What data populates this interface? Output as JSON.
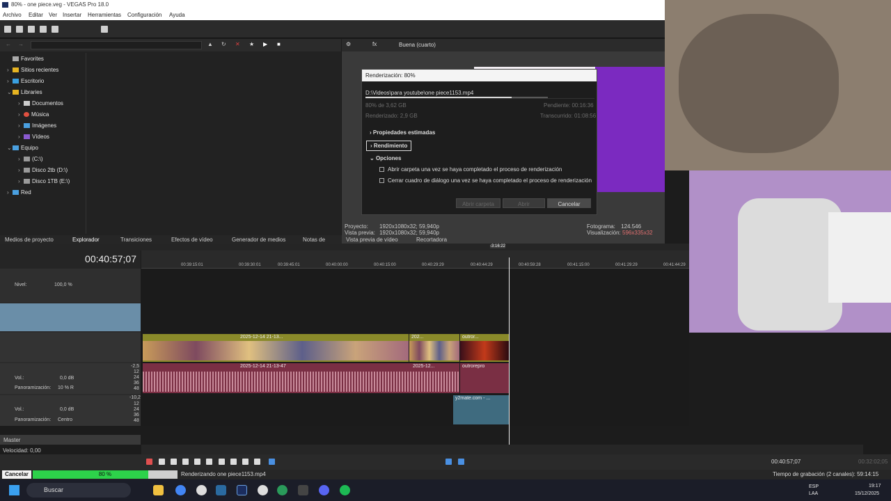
{
  "window": {
    "title": "80% - one piece.veg - VEGAS Pro 18.0"
  },
  "menu": [
    "Archivo",
    "Editar",
    "Ver",
    "Insertar",
    "Herramientas",
    "Configuración",
    "Ayuda"
  ],
  "explorer": {
    "tree": [
      {
        "label": "Favorites",
        "icon": "star-folder-icon"
      },
      {
        "label": "Sitios recientes",
        "icon": "folder-icon"
      },
      {
        "label": "Escritorio",
        "icon": "folder-icon"
      },
      {
        "label": "Libraries",
        "icon": "folder-icon"
      },
      {
        "label": "Documentos",
        "icon": "folder-icon"
      },
      {
        "label": "Música",
        "icon": "music-folder-icon"
      },
      {
        "label": "Imágenes",
        "icon": "folder-icon"
      },
      {
        "label": "Vídeos",
        "icon": "folder-icon"
      },
      {
        "label": "Equipo",
        "icon": "computer-icon"
      },
      {
        "label": "(C:\\)",
        "icon": "drive-icon"
      },
      {
        "label": "Disco 2tb (D:\\)",
        "icon": "drive-icon"
      },
      {
        "label": "Disco 1TB (E:\\)",
        "icon": "drive-icon"
      },
      {
        "label": "Red",
        "icon": "network-icon"
      }
    ]
  },
  "doc_tabs": [
    "Medios de proyecto",
    "Explorador",
    "Transiciones",
    "Efectos de vídeo",
    "Generador de medios",
    "Notas de"
  ],
  "preview": {
    "quality": "Buena (cuarto)",
    "proyecto_label": "Proyecto:",
    "proyecto_value": "1920x1080x32; 59,940p",
    "vista_label": "Vista previa:",
    "vista_value": "1920x1080x32; 59,940p",
    "fotograma_label": "Fotograma:",
    "fotograma_value": "124.546",
    "visualizacion_label": "Visualización:",
    "visualizacion_value": "596x335x32",
    "tabs": [
      "Vista previa de vídeo",
      "Recortadora"
    ]
  },
  "render_dialog": {
    "title": "Renderización: 80%",
    "path": "D:\\Videos\\para youtube\\one piece1153.mp4",
    "progress_text": "80% de 3,62 GB",
    "rendered_text": "Renderizado: 2,9 GB",
    "pending_text": "Pendiente: 00:16:36",
    "elapsed_text": "Transcurrido: 01:08:56",
    "progress_fraction": 0.8,
    "sections": [
      "Propiedades estimadas",
      "Rendimiento",
      "Opciones"
    ],
    "option1": "Abrir carpeta una vez se haya completado el proceso de renderización",
    "option2": "Cerrar cuadro de diálogo una vez se haya completado el proceso de renderización",
    "btn_open_folder": "Abrir carpeta",
    "btn_open": "Abrir",
    "btn_cancel": "Cancelar"
  },
  "timeline": {
    "timecode": "00:40:57;07",
    "playhead_label": "-3:16:22",
    "ruler": [
      "00:39:15:01",
      "00:39:30:01",
      "00:39:45:01",
      "00:40:00:00",
      "00:40:15:00",
      "00:40:29:29",
      "00:40:44:29",
      "00:40:59:28",
      "00:41:15:00",
      "00:41:29:29",
      "00:41:44:29"
    ],
    "track1": {
      "level_label": "Nivel:",
      "level_value": "100,0 %"
    },
    "audio1": {
      "vol_label": "Vol.:",
      "vol_value": "0,0 dB",
      "pan_label": "Panoramización:",
      "pan_value": "10 % R",
      "db_top": "-2,5",
      "ticks": [
        "12",
        "24",
        "36",
        "48"
      ]
    },
    "audio2": {
      "vol_label": "Vol.:",
      "vol_value": "0,0 dB",
      "pan_label": "Panoramización:",
      "pan_value": "Centro",
      "db_top": "-10,2",
      "ticks": [
        "12",
        "24",
        "36",
        "48"
      ]
    },
    "clips": {
      "v1": "2025-12-14 21-13...",
      "v2": "202...",
      "v3": "outror...",
      "a1": "2025-12-14 21-13-47",
      "a2": "2025-12...",
      "a3": "outrorepro",
      "b1": "y2mate.com - ..."
    },
    "master_label": "Master",
    "speed_label": "Velocidad: 0,00",
    "end_timecode": "00:40:57;07",
    "end_timecode2": "00:32:02;05"
  },
  "status": {
    "cancel": "Cancelar",
    "percent": "80 %",
    "progress_fraction": 0.8,
    "message": "Renderizando one piece1153.mp4",
    "record_time": "Tiempo de grabación (2 canales): 59:14:15"
  },
  "taskbar": {
    "search": "Buscar",
    "lang1": "ESP",
    "lang2": "LAA",
    "time": "19:17",
    "date": "15/12/2025"
  },
  "colors": {
    "progress_green": "#2dd24a",
    "video_clip": "#8a8a2a",
    "audio_clip": "#7a2f44",
    "accent_blue": "#1b2d5e"
  }
}
